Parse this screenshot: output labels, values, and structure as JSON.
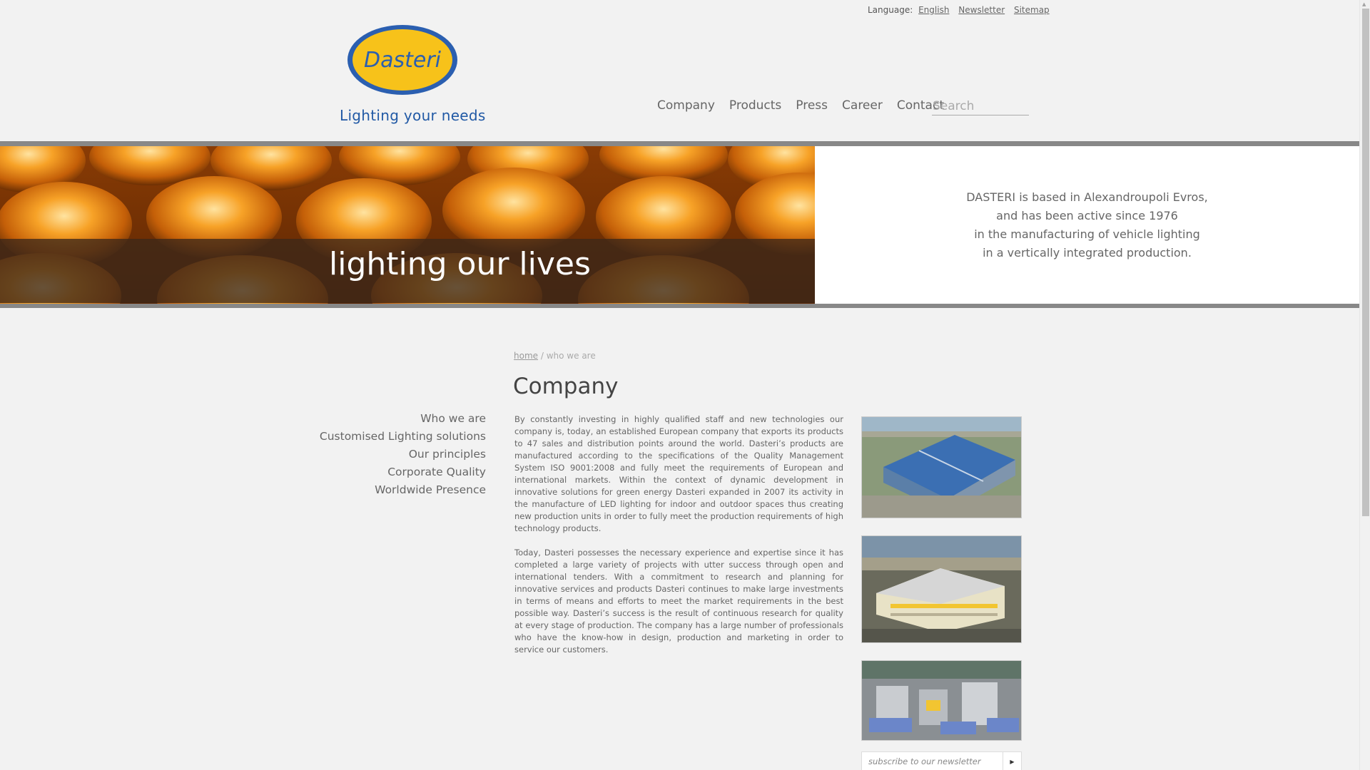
{
  "util": {
    "language_label": "Language:",
    "language_value": "English",
    "newsletter": "Newsletter",
    "sitemap": "Sitemap"
  },
  "logo": {
    "text": "Dasteri",
    "tagline": "Lighting your needs"
  },
  "nav": {
    "items": [
      "Company",
      "Products",
      "Press",
      "Career",
      "Contact"
    ],
    "search_placeholder": "Search"
  },
  "banner": {
    "caption": "lighting our lives",
    "text_lines": [
      "DASTERI is based in Alexandroupoli Evros,",
      "and has been active since 1976",
      "in the manufacturing of vehicle lighting",
      "in a vertically integrated production."
    ]
  },
  "breadcrumb": {
    "home": "home",
    "separator": "/",
    "current": "who we are"
  },
  "page_title": "Company",
  "sidebar": {
    "items": [
      "Who we are",
      "Customised Lighting solutions",
      "Our principles",
      "Corporate Quality",
      "Worldwide Presence"
    ]
  },
  "body": {
    "paragraphs": [
      "By constantly investing in highly qualified staff and new technologies our company is, today, an established European company that exports its products to 47 sales and distribution points around the world. Dasteri’s products are manufactured according to the specifications of the Quality Management System ISO 9001:2008 and fully meet the requirements of European and international markets. Within the context of dynamic development in innovative solutions for green energy Dasteri expanded in 2007 its activity in the manufacture of LED lighting for indoor and outdoor spaces thus creating new production units in order to fully meet the production requirements of high technology products.",
      "Today, Dasteri possesses the necessary experience and expertise since it has completed a large variety of projects with utter success through open and international tenders. With a commitment to research and planning for innovative services and products Dasteri continues to make large investments in terms of means and efforts to meet the market requirements in the best possible way. Dasteri’s success is the result of continuous research for quality at every stage of production. The company has a large number of professionals who have the know-how in design, production and marketing in order to service our customers."
    ]
  },
  "newsletter": {
    "placeholder": "subscribe to our newsletter"
  },
  "colors": {
    "logo_blue": "#2b5fb0",
    "logo_yellow": "#f7c21a",
    "tagline_blue": "#2159a5",
    "banner_orange": "#d97a10"
  },
  "icons": {
    "submit": "triangle-right-icon"
  }
}
